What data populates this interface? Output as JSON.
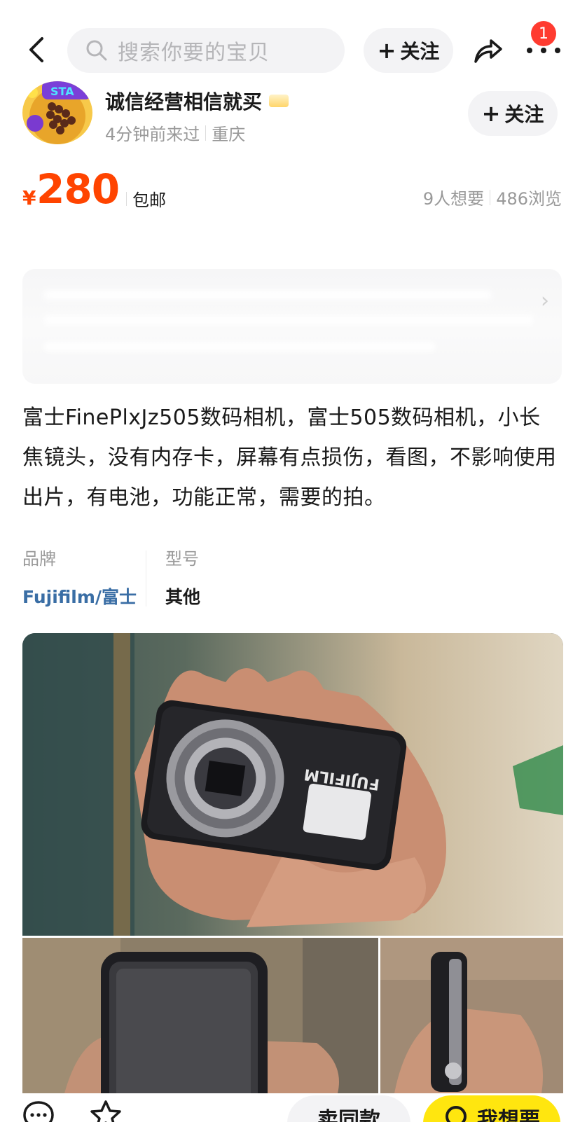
{
  "header": {
    "search_placeholder": "搜索你要的宝贝",
    "follow_label": "关注",
    "notification_count": "1",
    "icons": {
      "back": "chevron-left-icon",
      "search": "search-icon",
      "share": "share-icon",
      "more": "more-dots-icon"
    }
  },
  "seller": {
    "name": "诚信经营相信就买",
    "last_active": "4分钟前来过",
    "location": "重庆",
    "follow_label": "关注"
  },
  "listing": {
    "currency": "¥",
    "price": "280",
    "shipping": "包邮",
    "wants": "9人想要",
    "views": "486浏览",
    "description": "富士FinePlxJz505数码相机，富士505数码相机，小长焦镜头，没有内存卡，屏幕有点损伤，看图，不影响使用出片，有电池，功能正常，需要的拍。",
    "params": [
      {
        "label": "品牌",
        "value": "Fujifilm/富士"
      },
      {
        "label": "型号",
        "value": "其他"
      }
    ],
    "camera_brand_print": "FUJIFILM"
  },
  "bottom_bar": {
    "sell_similar": "卖同款",
    "want": "我想要",
    "icons": {
      "chat": "chat-icon",
      "favorite": "star-icon",
      "want": "chat-bubble-icon"
    }
  },
  "colors": {
    "price": "#ff4400",
    "brand_link": "#3a6ea5",
    "want_button": "#ffe60f",
    "badge": "#ff3b30"
  }
}
